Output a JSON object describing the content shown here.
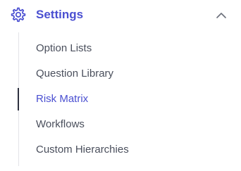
{
  "settings": {
    "title": "Settings",
    "expanded": true,
    "icon": "gear-icon",
    "toggle_icon": "chevron-up-icon",
    "items": [
      {
        "label": "Option Lists",
        "active": false
      },
      {
        "label": "Question Library",
        "active": false
      },
      {
        "label": "Risk Matrix",
        "active": true
      },
      {
        "label": "Workflows",
        "active": false
      },
      {
        "label": "Custom Hierarchies",
        "active": false
      }
    ]
  },
  "colors": {
    "accent": "#4a4fd1",
    "text": "#4a4f5c",
    "indicator": "#2e3140",
    "divider": "#e3e4e8",
    "chevron": "#6b6f7a"
  }
}
